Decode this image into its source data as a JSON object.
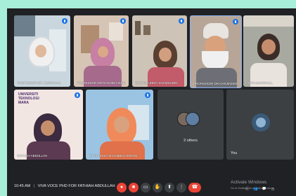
{
  "participants_top": [
    "PROFESSOR DR. ZURAINI AL",
    "PROFESSOR DR RASHIDA ZUBAIRA",
    "SABRINA BINTI SHAMSUDIN",
    "PROFESSOR DR HARJINDER SINGH",
    "ANITA MARSHALL"
  ],
  "participants_bottom": [
    "FATHIAH ABDULLAH",
    "DR SHAHIZA SHAHIBE KAMSANI"
  ],
  "others": {
    "label": "2 others"
  },
  "you": {
    "label": "You"
  },
  "university_logo": {
    "line1": "UNIVERSITI",
    "line2": "TEKNOLOGI",
    "line3": "MARA"
  },
  "meeting_info": {
    "time": "10:45 AM",
    "separator": "|",
    "title": "VIVA VOCE PHD FOR FATHIAH ABDULLAH"
  },
  "watermark": {
    "line1": "Activate Windows",
    "line2": "Go to Settings to activate Windows."
  },
  "colors": {
    "background": "#a7efd8",
    "meeting_bg": "#202124",
    "end_call": "#ea4335",
    "pin_blue": "#1a73e8"
  },
  "icons": [
    "mic-icon",
    "camera-icon",
    "captions-icon",
    "raise-hand-icon",
    "present-icon",
    "more-icon",
    "end-call-icon",
    "info-icon",
    "people-icon",
    "chat-icon",
    "activities-icon"
  ]
}
